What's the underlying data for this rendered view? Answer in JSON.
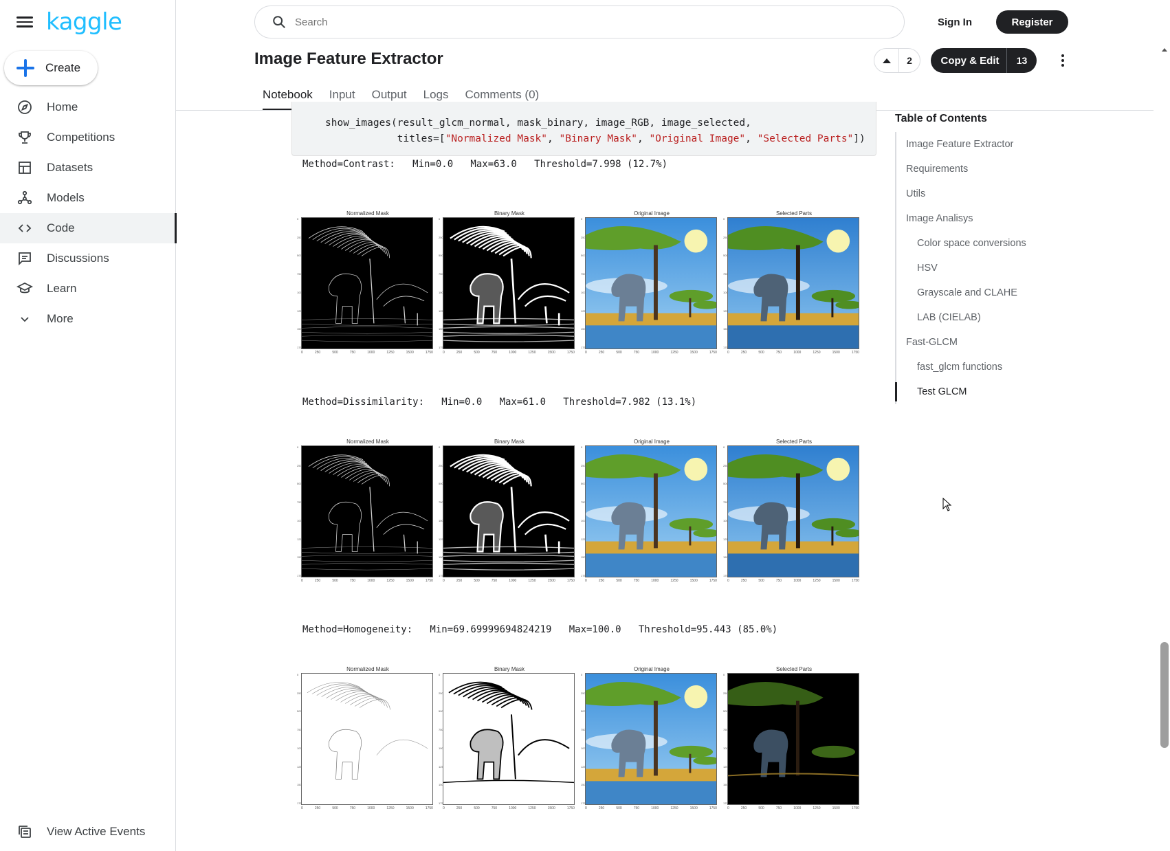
{
  "brand": {
    "logo_text": "kaggle",
    "accent": "#20beff"
  },
  "sidebar": {
    "create_label": "Create",
    "items": [
      {
        "label": "Home",
        "icon": "compass-icon",
        "active": false
      },
      {
        "label": "Competitions",
        "icon": "trophy-icon",
        "active": false
      },
      {
        "label": "Datasets",
        "icon": "table-icon",
        "active": false
      },
      {
        "label": "Models",
        "icon": "models-icon",
        "active": false
      },
      {
        "label": "Code",
        "icon": "code-icon",
        "active": true
      },
      {
        "label": "Discussions",
        "icon": "discussion-icon",
        "active": false
      },
      {
        "label": "Learn",
        "icon": "graduation-cap-icon",
        "active": false
      },
      {
        "label": "More",
        "icon": "chevron-down-icon",
        "active": false
      }
    ],
    "view_active_events": "View Active Events"
  },
  "header": {
    "search_placeholder": "Search",
    "sign_in": "Sign In",
    "register": "Register"
  },
  "notebook": {
    "title": "Image Feature Extractor",
    "vote_count": "2",
    "copy_edit_label": "Copy & Edit",
    "copy_edit_count": "13",
    "tabs": [
      "Notebook",
      "Input",
      "Output",
      "Logs",
      "Comments (0)"
    ],
    "active_tab": "Notebook"
  },
  "code": {
    "line1": "show_images(result_glcm_normal, mask_binary, image_RGB, image_selected,",
    "line2_prefix": "            titles=[",
    "titles": [
      "\"Normalized Mask\"",
      "\"Binary Mask\"",
      "\"Original Image\"",
      "\"Selected Parts\""
    ],
    "line2_suffix": "])"
  },
  "outputs": [
    {
      "text": "Method=Contrast:   Min=0.0   Max=63.0   Threshold=7.998 (12.7%)",
      "variant": "contrast"
    },
    {
      "text": "Method=Dissimilarity:   Min=0.0   Max=61.0   Threshold=7.982 (13.1%)",
      "variant": "dissimilarity"
    },
    {
      "text": "Method=Homogeneity:   Min=69.69999694824219   Max=100.0   Threshold=95.443 (85.0%)",
      "variant": "homogeneity"
    }
  ],
  "figure": {
    "panel_titles": [
      "Normalized Mask",
      "Binary Mask",
      "Original Image",
      "Selected Parts"
    ],
    "x_ticks": [
      "0",
      "250",
      "500",
      "750",
      "1000",
      "1250",
      "1500",
      "1750"
    ],
    "y_ticks": [
      "0",
      "250",
      "500",
      "750",
      "1000",
      "1250",
      "1500",
      "1750"
    ]
  },
  "toc": {
    "title": "Table of Contents",
    "items": [
      {
        "label": "Image Feature Extractor",
        "level": 1
      },
      {
        "label": "Requirements",
        "level": 1
      },
      {
        "label": "Utils",
        "level": 1
      },
      {
        "label": "Image Analisys",
        "level": 1
      },
      {
        "label": "Color space conversions",
        "level": 2
      },
      {
        "label": "HSV",
        "level": 2
      },
      {
        "label": "Grayscale and CLAHE",
        "level": 2
      },
      {
        "label": "LAB (CIELAB)",
        "level": 2
      },
      {
        "label": "Fast-GLCM",
        "level": 1
      },
      {
        "label": "fast_glcm functions",
        "level": 2
      },
      {
        "label": "Test GLCM",
        "level": 2,
        "active": true
      }
    ]
  }
}
